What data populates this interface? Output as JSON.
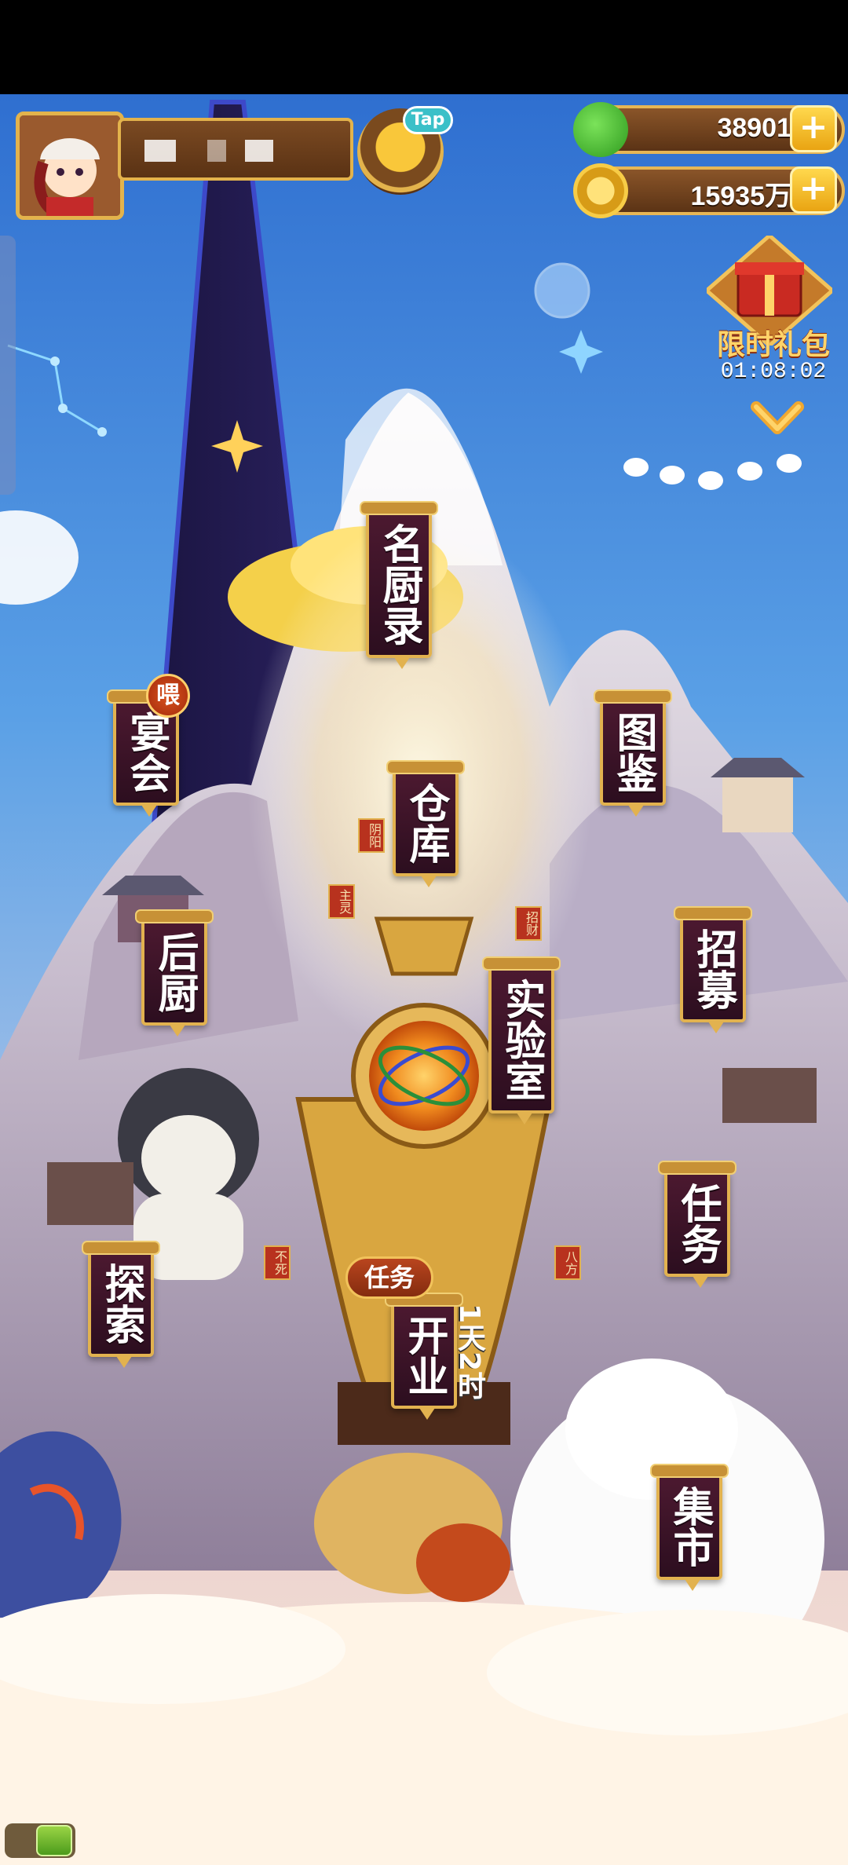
{
  "hud": {
    "tap_label": "Tap",
    "currencies": [
      {
        "name": "green-gem",
        "value": "38901"
      },
      {
        "name": "coin",
        "value": "15935万"
      }
    ],
    "plus_label": "+"
  },
  "gift_pack": {
    "label": "限时礼包",
    "timer": "01:08:02"
  },
  "buildings": [
    {
      "id": "chef-records",
      "label": "名厨录"
    },
    {
      "id": "banquet",
      "label": "宴会",
      "badge": "喂"
    },
    {
      "id": "codex",
      "label": "图鉴"
    },
    {
      "id": "warehouse",
      "label": "仓库"
    },
    {
      "id": "back-kitchen",
      "label": "后厨"
    },
    {
      "id": "laboratory",
      "label": "实验室"
    },
    {
      "id": "recruit",
      "label": "招募"
    },
    {
      "id": "tasks",
      "label": "任务"
    },
    {
      "id": "explore",
      "label": "探索"
    },
    {
      "id": "open-business",
      "label": "开业",
      "task_pill": "任务",
      "countdown": "1天2时"
    },
    {
      "id": "market",
      "label": "集市"
    }
  ],
  "small_plaques": [
    "阴阳",
    "主灵",
    "招财",
    "不死",
    "八方"
  ],
  "colors": {
    "sky_top": "#3b7ad6",
    "sky_bottom": "#f3d7c6",
    "banner": "#3a1326",
    "gold": "#e2b24f",
    "currency_bar": "#6d3f1c"
  }
}
